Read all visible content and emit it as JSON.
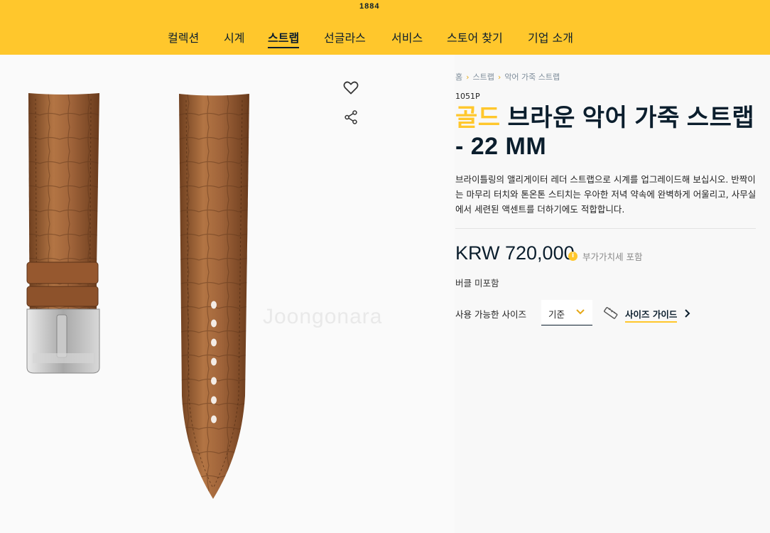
{
  "header": {
    "brand_year": "1884",
    "nav": [
      {
        "label": "컬렉션"
      },
      {
        "label": "시계"
      },
      {
        "label": "스트랩",
        "active": true
      },
      {
        "label": "선글라스"
      },
      {
        "label": "서비스"
      },
      {
        "label": "스토어 찾기"
      },
      {
        "label": "기업 소개"
      }
    ]
  },
  "colors": {
    "brand_yellow": "#ffc72c",
    "navy": "#0b1e2d",
    "strap_brown": "#a0643a"
  },
  "product_actions": {
    "favorite_icon": "heart-icon",
    "share_icon": "share-icon"
  },
  "watermark": "Joongonara",
  "breadcrumb": [
    "홈",
    "스트랩",
    "악어 가죽 스트랩"
  ],
  "product": {
    "ref": "1051P",
    "title_accent": "골드",
    "title_rest": " 브라운 악어 가죽 스트랩 - 22 MM",
    "description": "브라이틀링의 앨리게이터 레더 스트랩으로 시계를 업그레이드해 보십시오. 반짝이는 마무리 터치와 톤온톤 스티치는 우아한 저녁 약속에 완벽하게 어울리고, 사무실에서 세련된 액센트를 더하기에도 적합합니다.",
    "price": "KRW 720,000",
    "vat_note": "부가가치세 포함",
    "buckle_note": "버클 미포함",
    "size_label": "사용 가능한 사이즈",
    "size_value": "기준",
    "size_guide": "사이즈 가이드"
  }
}
